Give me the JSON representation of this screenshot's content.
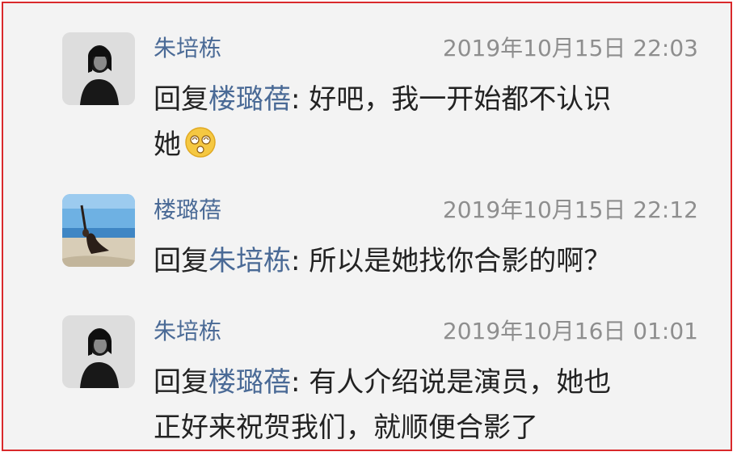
{
  "comments": [
    {
      "author": "朱培栋",
      "time": "2019年10月15日 22:03",
      "reply_prefix": "回复",
      "mention": "楼璐蓓",
      "text_line1": ": 好吧，我一开始都不认识",
      "text_line2": "她",
      "emoji": "dizzy-face-emoji"
    },
    {
      "author": "楼璐蓓",
      "time": "2019年10月15日 22:12",
      "reply_prefix": "回复",
      "mention": "朱培栋",
      "text_line1": ": 所以是她找你合影的啊？"
    },
    {
      "author": "朱培栋",
      "time": "2019年10月16日 01:01",
      "reply_prefix": "回复",
      "mention": "楼璐蓓",
      "text_line1": ": 有人介绍说是演员，她也",
      "text_line2": "正好来祝贺我们，就顺便合影了"
    }
  ],
  "colors": {
    "frame_border": "#d9292b",
    "background": "#f3f3f3",
    "name_link": "#4a6a96",
    "timestamp": "#8e8e8e",
    "body_text": "#222222"
  }
}
